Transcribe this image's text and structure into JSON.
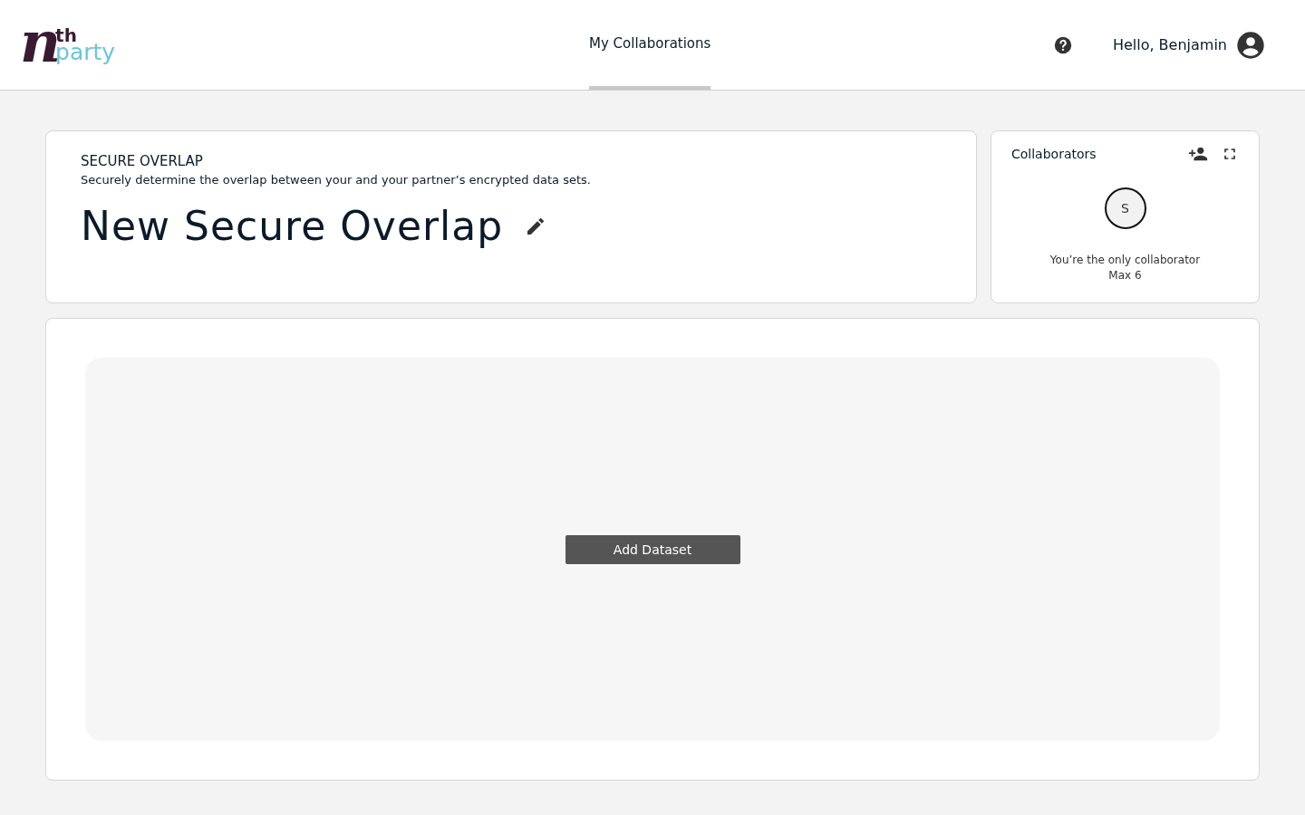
{
  "logo": {
    "letter": "n",
    "superscript": "th",
    "word": "party"
  },
  "nav": [
    {
      "label": "My Collaborations",
      "selected": true
    }
  ],
  "user": {
    "greeting": "Hello, Benjamin"
  },
  "overview": {
    "kind_label": "SECURE OVERLAP",
    "description": "Securely determine the overlap between your and your partner’s encrypted data sets.",
    "title": "New Secure Overlap"
  },
  "collaborators": {
    "title": "Collaborators",
    "avatars": [
      "S"
    ],
    "message": "You’re the only collaborator",
    "limit": "Max 6"
  },
  "datasets": {
    "button": "Add Dataset"
  }
}
